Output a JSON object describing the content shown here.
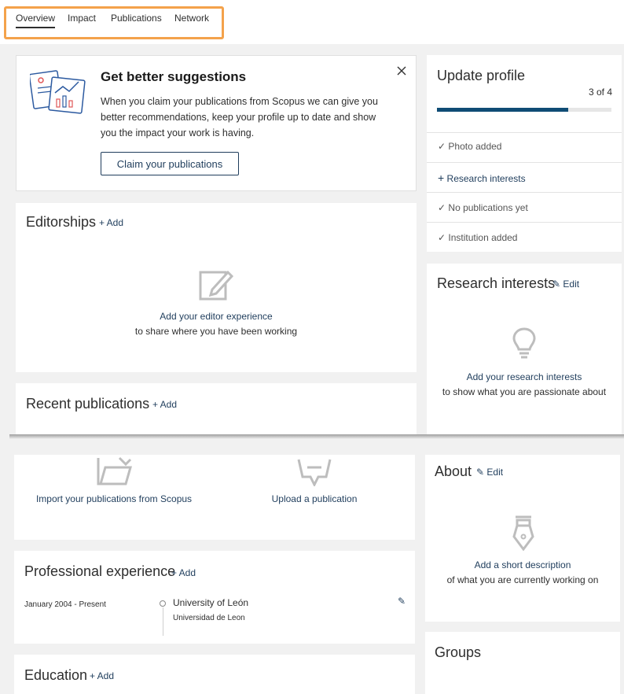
{
  "tabs": [
    {
      "label": "Overview",
      "active": true
    },
    {
      "label": "Impact"
    },
    {
      "label": "Publications"
    },
    {
      "label": "Network"
    }
  ],
  "suggestion": {
    "title": "Get better suggestions",
    "body_lines": [
      "When you claim your publications from Scopus we can give you",
      "better recommendations, keep your profile up to date and show",
      "you the impact your work is having."
    ],
    "button": "Claim your publications",
    "close_icon": "close-icon"
  },
  "update_profile": {
    "title": "Update profile",
    "count": "3 of 4",
    "progress": 0.75,
    "items": [
      {
        "mark": "✓",
        "label": "Photo added"
      },
      {
        "mark": "+",
        "label": "Research interests"
      },
      {
        "mark": "✓",
        "label": "No publications yet"
      },
      {
        "mark": "✓",
        "label": "Institution added"
      }
    ]
  },
  "editorships": {
    "title": "Editorships",
    "add": "+ Add",
    "empty_link": "Add your editor experience",
    "empty_text": "to share where you have been working"
  },
  "research_interests": {
    "title": "Research interests",
    "edit": "Edit",
    "empty_link": "Add your research interests",
    "empty_text": "to show what you are passionate about"
  },
  "recent_publications": {
    "title": "Recent publications",
    "add": "+ Add",
    "import_label": "Import your publications from Scopus",
    "upload_label": "Upload a publication"
  },
  "about": {
    "title": "About",
    "edit": "Edit",
    "empty_link": "Add a short description",
    "empty_text": "of what you are currently working on"
  },
  "experience": {
    "title": "Professional experience",
    "add": "+ Add",
    "entry": {
      "dates": "January 2004 - Present",
      "institution": "University of León",
      "subtitle": "Universidad de Leon"
    }
  },
  "groups": {
    "title": "Groups"
  },
  "education": {
    "title": "Education",
    "add": "+ Add"
  },
  "colors": {
    "accent": "#1f3d5c",
    "progress_fill": "#0f4c75",
    "highlight": "#f4a24b"
  }
}
